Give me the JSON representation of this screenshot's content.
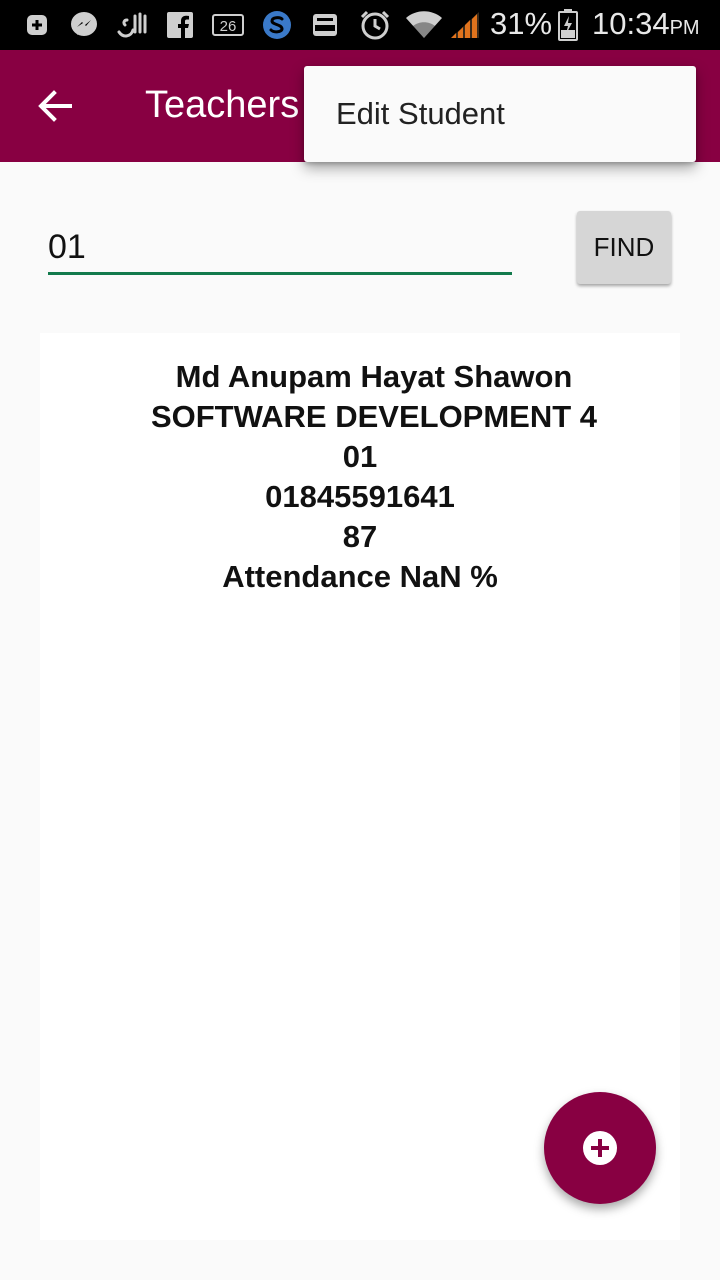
{
  "status_bar": {
    "battery": "31%",
    "time": "10:34",
    "ampm": "PM",
    "notification_badge": "26",
    "icons": [
      "add-box-icon",
      "messenger-icon",
      "allah-calligraphy-icon",
      "facebook-icon",
      "calendar-icon",
      "skype-icon",
      "inbox-icon",
      "alarm-icon",
      "wifi-icon",
      "signal-icon",
      "battery-icon"
    ]
  },
  "app_bar": {
    "title": "Teachers",
    "background": "#880042"
  },
  "overflow_menu": {
    "items": [
      {
        "label": "Edit Student"
      }
    ]
  },
  "search": {
    "value": "01",
    "placeholder": "",
    "button_label": "FIND"
  },
  "result": {
    "name": "Md Anupam Hayat Shawon",
    "course": "SOFTWARE DEVELOPMENT 4",
    "id": "01",
    "phone": "01845591641",
    "number": "87",
    "attendance": "Attendance NaN %"
  },
  "fab": {
    "icon": "add-circle-icon"
  },
  "colors": {
    "accent": "#880042",
    "input_underline": "#127a4c"
  }
}
